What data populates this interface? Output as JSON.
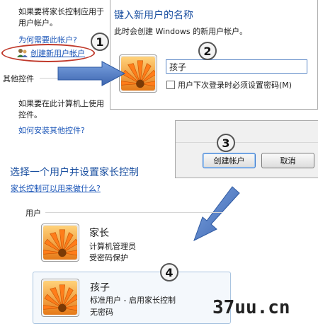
{
  "top_left": {
    "line1": "如果要将家长控制应用于",
    "line2": "用户帐户。",
    "why_link": "为何需要此帐户?",
    "create_link": "创建新用户帐户",
    "other_heading": "其他控件",
    "other_line1": "如果要在此计算机上使用",
    "other_line2": "控件。",
    "install_link": "如何安装其他控件?"
  },
  "dialog": {
    "title": "键入新用户的名称",
    "subtitle": "此时会创建 Windows 的新用户帐户。",
    "name_value": "孩子",
    "checkbox_label": "用户下次登录时必须设置密码(M)"
  },
  "buttons": {
    "create": "创建帐户",
    "cancel": "取消"
  },
  "select_section": {
    "heading": "选择一个用户并设置家长控制",
    "help_link": "家长控制可以用来做什么?",
    "users_label": "用户"
  },
  "users": [
    {
      "name": "家长",
      "line1": "计算机管理员",
      "line2": "受密码保护"
    },
    {
      "name": "孩子",
      "line1": "标准用户 - 启用家长控制",
      "line2": "无密码"
    }
  ],
  "steps": [
    "1",
    "2",
    "3",
    "4"
  ],
  "watermark": "37uu.cn",
  "icons": {
    "user_icon": "users-icon",
    "avatar": "orange-flower-avatar",
    "arrow": "blue-arrow"
  },
  "colors": {
    "link": "#1a55b8",
    "heading": "#1a55b8",
    "arrow": "#5b82c8",
    "oval": "#c0392b"
  }
}
